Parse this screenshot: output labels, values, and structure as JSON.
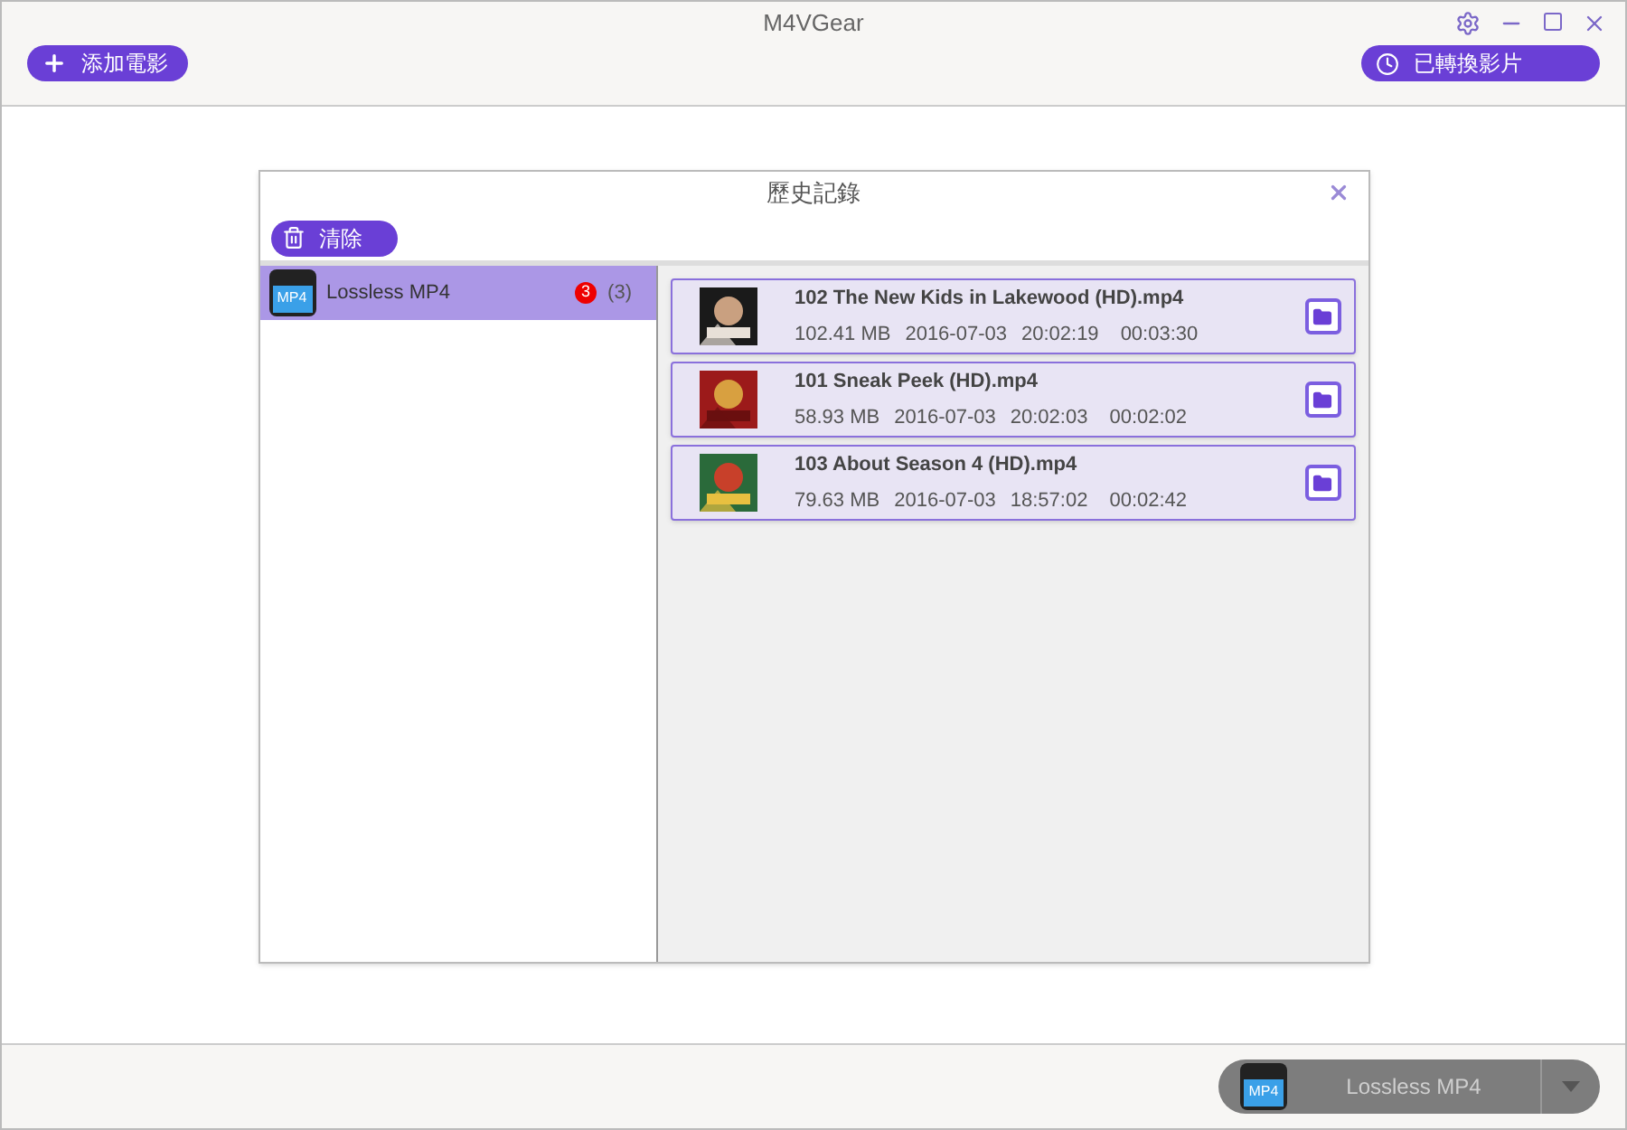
{
  "window": {
    "title": "M4VGear"
  },
  "toolbar": {
    "add_button": "添加電影",
    "history_button": "已轉換影片"
  },
  "dialog": {
    "title": "歷史記錄",
    "clear_button": "清除",
    "formats": [
      {
        "icon_label": "MP4",
        "name": "Lossless MP4",
        "badge": "3",
        "count": "(3)",
        "selected": true
      }
    ],
    "files": [
      {
        "name": "102 The New Kids in Lakewood (HD).mp4",
        "size": "102.41 MB",
        "date": "2016-07-03",
        "time": "20:02:19",
        "duration": "00:03:30"
      },
      {
        "name": "101 Sneak Peek (HD).mp4",
        "size": "58.93 MB",
        "date": "2016-07-03",
        "time": "20:02:03",
        "duration": "00:02:02"
      },
      {
        "name": "103 About Season 4 (HD).mp4",
        "size": "79.63 MB",
        "date": "2016-07-03",
        "time": "18:57:02",
        "duration": "00:02:42"
      }
    ]
  },
  "output": {
    "icon_label": "MP4",
    "format": "Lossless MP4"
  }
}
